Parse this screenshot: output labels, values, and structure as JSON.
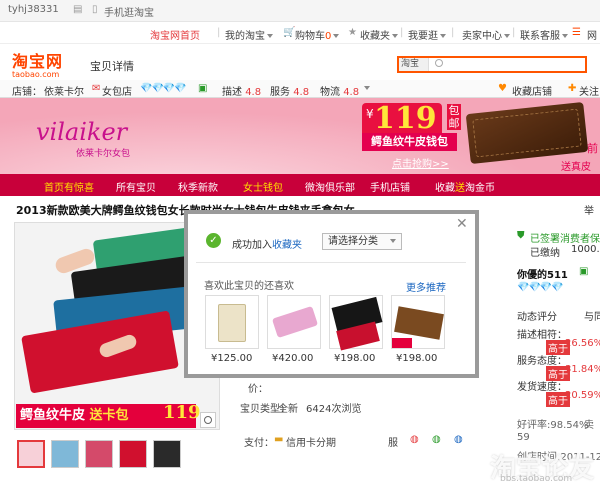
{
  "topbar": {
    "user": "tyhj38331",
    "mobile_label": "手机逛淘宝",
    "links": [
      "淘宝网首页",
      "我的淘宝",
      "购物车",
      "收藏夹",
      "我要逛",
      "卖家中心",
      "联系客服",
      "网"
    ],
    "cart_count": "0"
  },
  "logo": {
    "name": "淘宝网",
    "domain": "taobao.com"
  },
  "page_label": "宝贝详情",
  "search": {
    "tab": "淘宝"
  },
  "shop": {
    "label": "店铺：",
    "name": "依莱卡尔",
    "shop_type": "女包店",
    "ratings": [
      {
        "label": "描述",
        "value": "4.8"
      },
      {
        "label": "服务",
        "value": "4.8"
      },
      {
        "label": "物流",
        "value": "4.8"
      }
    ],
    "favorite": "收藏店铺",
    "follow": "关注"
  },
  "banner": {
    "brand": "vilaiker",
    "brand_sub": "依莱卡尔女包",
    "currency": "¥",
    "price": "119",
    "shipping": "包邮",
    "title": "鳄鱼纹牛皮钱包",
    "cta": "点击抢购>>",
    "right_top": "前",
    "right_bottom": "送真皮"
  },
  "shop_nav": [
    "首页有惊喜",
    "所有宝贝",
    "秋季新款",
    "女士钱包",
    "微淘俱乐部",
    "手机店铺",
    "收藏送淘金币"
  ],
  "product": {
    "title": "2013新款欧美大牌鳄鱼纹钱包女长款时尚女士钱包牛皮钱夹手拿包女",
    "title_right": "举",
    "image_caption": "鳄鱼纹牛皮",
    "image_caption_gift": "送卡包",
    "image_caption_price": "119"
  },
  "details": {
    "price_label": "价：",
    "condition_label": "宝贝类型：",
    "condition": "全新",
    "views": "6424次浏览",
    "pay_label": "支付：",
    "installment": "信用卡分期",
    "trailing": "服"
  },
  "modal": {
    "success": "成功加入",
    "success_link": "收藏夹",
    "category_select": "请选择分类",
    "like_title": "喜欢此宝贝的还喜欢",
    "more": "更多推荐",
    "items": [
      {
        "price": "¥125.00"
      },
      {
        "price": "¥420.00"
      },
      {
        "price": "¥198.00"
      },
      {
        "price": "¥198.00"
      }
    ]
  },
  "seller": {
    "guarantee": "已签署消费者保",
    "paid": "已缴纳",
    "paid_amount": "1000.",
    "nick": "你優的511",
    "eval_label": "动态评分",
    "eval_right": "与同",
    "scores": [
      {
        "label": "描述相符：",
        "tag": "高于",
        "value": "26.56%"
      },
      {
        "label": "服务态度：",
        "tag": "高于",
        "value": "31.84%"
      },
      {
        "label": "发货速度：",
        "tag": "高于",
        "value": "20.59%"
      }
    ],
    "good_rate": "好评率:98.54%",
    "good_rate_tail": "卖",
    "good_count": "59",
    "opened": "创店时间:2011-12"
  },
  "watermark": {
    "main": "淘宝论友",
    "sub": "bbs.taobao.com"
  },
  "colors": {
    "brand": "#ff4400",
    "banner": "#f4a6b8",
    "nav": "#c8003a",
    "accent": "#e4393c"
  }
}
